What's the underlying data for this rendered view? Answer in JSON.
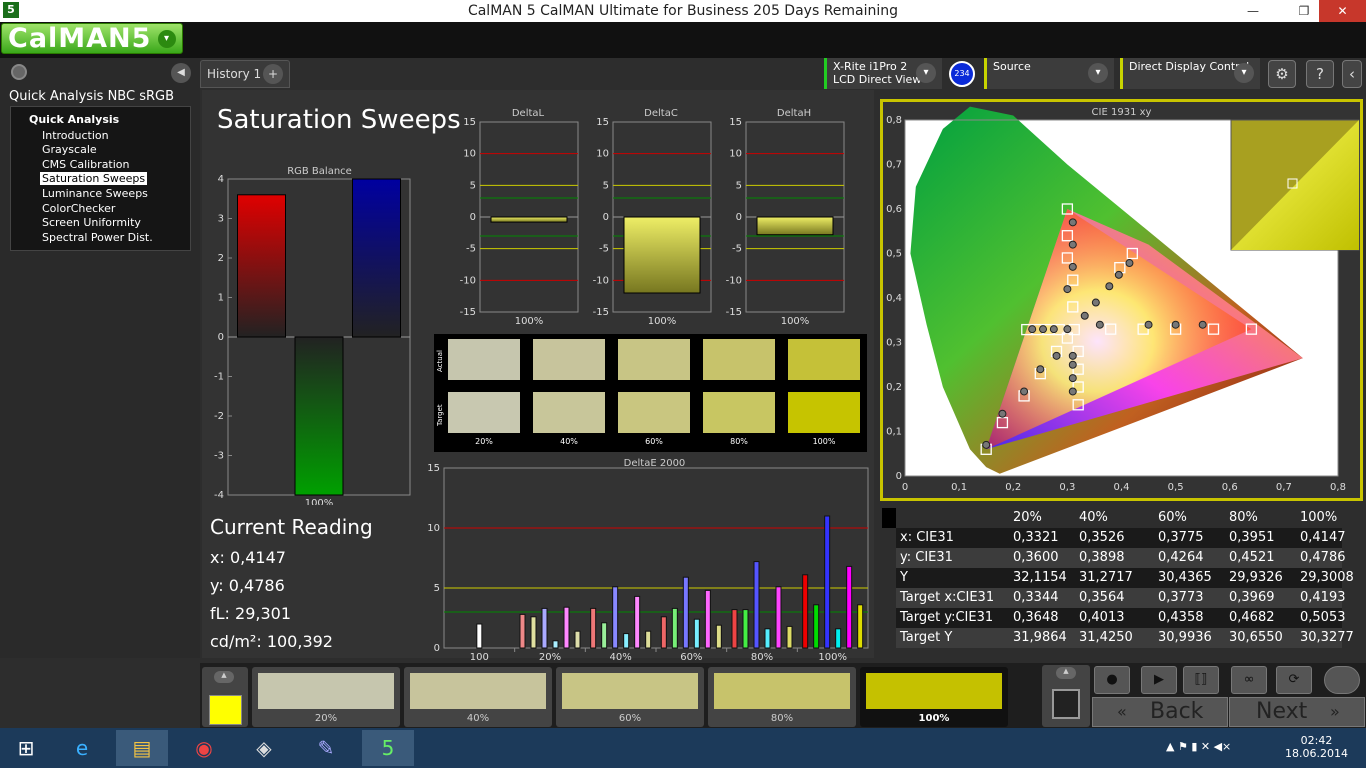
{
  "window": {
    "title": "CalMAN 5 CalMAN Ultimate for Business 205 Days Remaining",
    "app_icon": "5",
    "min": "—",
    "max": "❐",
    "close": "✕"
  },
  "logo": {
    "text": "CalMAN5",
    "dropdown": "▾"
  },
  "nav": {
    "title": "Quick Analysis NBC sRGB",
    "root": "Quick Analysis",
    "items": [
      "Introduction",
      "Grayscale",
      "CMS Calibration",
      "Saturation Sweeps",
      "Luminance Sweeps",
      "ColorChecker",
      "Screen Uniformity",
      "Spectral Power Dist."
    ],
    "selected_index": 3
  },
  "tabs": {
    "history": "History 1",
    "add": "+"
  },
  "devices": {
    "meter_line1": "X-Rite i1Pro 2",
    "meter_line2": "LCD Direct View",
    "meter_badge": "234",
    "source": "Source",
    "display": "Direct Display Control"
  },
  "toolbar_icons": [
    "gear-icon",
    "help-icon",
    "collapse-icon"
  ],
  "page": {
    "title": "Saturation Sweeps"
  },
  "current_reading": {
    "heading": "Current Reading",
    "x": "x: 0,4147",
    "y": "y: 0,4786",
    "fl": "fL: 29,301",
    "cdm2": "cd/m²: 100,392"
  },
  "swatch_labels": {
    "actual": "Actual",
    "target": "Target",
    "levels": [
      "20%",
      "40%",
      "60%",
      "80%",
      "100%"
    ]
  },
  "swatch_colors": {
    "actual": [
      "#c6c6ae",
      "#c7c49c",
      "#c8c585",
      "#c7c36b",
      "#c5c138"
    ],
    "target": [
      "#c8c8b0",
      "#c8c69a",
      "#c9c680",
      "#c8c662",
      "#c6c400"
    ]
  },
  "chart_data": [
    {
      "type": "bar",
      "title": "RGB Balance",
      "categories": [
        "100%"
      ],
      "series": [
        {
          "name": "R",
          "values": [
            3.6
          ],
          "color": "#e00000"
        },
        {
          "name": "G",
          "values": [
            -4.0
          ],
          "color": "#00a000"
        },
        {
          "name": "B",
          "values": [
            4.0
          ],
          "color": "#0000a0"
        }
      ],
      "ylim": [
        -4,
        4
      ],
      "yticks": [
        "4",
        "3",
        "2",
        "1",
        "0",
        "-1",
        "-2",
        "-3",
        "-4"
      ],
      "xlabel": "100%"
    },
    {
      "type": "bar",
      "title": "DeltaL",
      "categories": [
        "100%"
      ],
      "values": [
        -0.8
      ],
      "ylim": [
        -15,
        15
      ],
      "yticks": [
        "15",
        "10",
        "5",
        "0",
        "-5",
        "-10",
        "-15"
      ]
    },
    {
      "type": "bar",
      "title": "DeltaC",
      "categories": [
        "100%"
      ],
      "values": [
        -12
      ],
      "ylim": [
        -15,
        15
      ],
      "yticks": [
        "15",
        "10",
        "5",
        "0",
        "-5",
        "-10",
        "-15"
      ]
    },
    {
      "type": "bar",
      "title": "DeltaH",
      "categories": [
        "100%"
      ],
      "values": [
        -2.8
      ],
      "ylim": [
        -15,
        15
      ],
      "yticks": [
        "15",
        "10",
        "5",
        "0",
        "-5",
        "-10",
        "-15"
      ]
    },
    {
      "type": "bar",
      "title": "DeltaE 2000",
      "categories": [
        "100",
        "20%",
        "40%",
        "60%",
        "80%",
        "100%"
      ],
      "ylim": [
        0,
        15
      ],
      "yticks": [
        "15",
        "10",
        "5",
        "0"
      ],
      "groups": [
        {
          "values": [
            2.0
          ],
          "colors": [
            "#ffffff"
          ]
        },
        {
          "values": [
            2.8,
            2.6,
            3.3,
            0.6,
            3.4,
            1.4
          ],
          "colors": [
            "#e88",
            "#e0e0a0",
            "#aaf",
            "#aef",
            "#f8f",
            "#dda"
          ]
        },
        {
          "values": [
            3.3,
            2.1,
            5.1,
            1.2,
            4.3,
            1.4
          ],
          "colors": [
            "#e77",
            "#9e9",
            "#88f",
            "#8ef",
            "#f8f",
            "#dd9"
          ]
        },
        {
          "values": [
            2.6,
            3.3,
            5.9,
            2.4,
            4.8,
            1.9
          ],
          "colors": [
            "#e66",
            "#7e7",
            "#77f",
            "#7ef",
            "#f6f",
            "#dd8"
          ]
        },
        {
          "values": [
            3.2,
            3.2,
            7.2,
            1.6,
            5.1,
            1.8
          ],
          "colors": [
            "#e44",
            "#4e4",
            "#55f",
            "#5ef",
            "#f4f",
            "#dd6"
          ]
        },
        {
          "values": [
            6.1,
            3.6,
            11.0,
            1.6,
            6.8,
            3.6
          ],
          "colors": [
            "#e00",
            "#0d0",
            "#33f",
            "#0ee",
            "#f0f",
            "#dd0"
          ]
        }
      ]
    },
    {
      "type": "scatter",
      "title": "CIE 1931 xy",
      "xlim": [
        0,
        0.8
      ],
      "ylim": [
        0,
        0.8
      ],
      "xticks": [
        "0",
        "0,1",
        "0,2",
        "0,3",
        "0,4",
        "0,5",
        "0,6",
        "0,7",
        "0,8"
      ],
      "yticks": [
        "0",
        "0,1",
        "0,2",
        "0,3",
        "0,4",
        "0,5",
        "0,6",
        "0,7",
        "0,8"
      ],
      "targets": [
        [
          0.3127,
          0.329
        ],
        [
          0.64,
          0.33
        ],
        [
          0.57,
          0.33
        ],
        [
          0.5,
          0.33
        ],
        [
          0.44,
          0.33
        ],
        [
          0.38,
          0.33
        ],
        [
          0.3,
          0.6
        ],
        [
          0.3,
          0.54
        ],
        [
          0.3,
          0.49
        ],
        [
          0.31,
          0.44
        ],
        [
          0.31,
          0.38
        ],
        [
          0.15,
          0.06
        ],
        [
          0.18,
          0.12
        ],
        [
          0.22,
          0.18
        ],
        [
          0.25,
          0.23
        ],
        [
          0.28,
          0.28
        ],
        [
          0.225,
          0.329
        ],
        [
          0.245,
          0.329
        ],
        [
          0.265,
          0.329
        ],
        [
          0.285,
          0.329
        ],
        [
          0.32,
          0.16
        ],
        [
          0.32,
          0.2
        ],
        [
          0.32,
          0.24
        ],
        [
          0.32,
          0.28
        ],
        [
          0.3,
          0.31
        ],
        [
          0.42,
          0.5
        ],
        [
          0.3969,
          0.4682
        ]
      ],
      "actuals": [
        [
          0.3321,
          0.36
        ],
        [
          0.3526,
          0.3898
        ],
        [
          0.3775,
          0.4264
        ],
        [
          0.3951,
          0.4521
        ],
        [
          0.4147,
          0.4786
        ],
        [
          0.45,
          0.34
        ],
        [
          0.5,
          0.34
        ],
        [
          0.55,
          0.34
        ],
        [
          0.36,
          0.34
        ],
        [
          0.31,
          0.57
        ],
        [
          0.31,
          0.52
        ],
        [
          0.31,
          0.47
        ],
        [
          0.3,
          0.42
        ],
        [
          0.15,
          0.07
        ],
        [
          0.18,
          0.14
        ],
        [
          0.22,
          0.19
        ],
        [
          0.25,
          0.24
        ],
        [
          0.28,
          0.27
        ],
        [
          0.235,
          0.33
        ],
        [
          0.255,
          0.33
        ],
        [
          0.275,
          0.33
        ],
        [
          0.3,
          0.33
        ],
        [
          0.31,
          0.19
        ],
        [
          0.31,
          0.22
        ],
        [
          0.31,
          0.25
        ],
        [
          0.31,
          0.27
        ]
      ]
    }
  ],
  "cie_table": {
    "headers": [
      "",
      "20%",
      "40%",
      "60%",
      "80%",
      "100%"
    ],
    "rows": [
      [
        "x: CIE31",
        "0,3321",
        "0,3526",
        "0,3775",
        "0,3951",
        "0,4147"
      ],
      [
        "y: CIE31",
        "0,3600",
        "0,3898",
        "0,4264",
        "0,4521",
        "0,4786"
      ],
      [
        "Y",
        "32,1154",
        "31,2717",
        "30,4365",
        "29,9326",
        "29,3008"
      ],
      [
        "Target x:CIE31",
        "0,3344",
        "0,3564",
        "0,3773",
        "0,3969",
        "0,4193"
      ],
      [
        "Target y:CIE31",
        "0,3648",
        "0,4013",
        "0,4358",
        "0,4682",
        "0,5053"
      ],
      [
        "Target Y",
        "31,9864",
        "31,4250",
        "30,9936",
        "30,6550",
        "30,3277"
      ]
    ]
  },
  "bottom_swatches": {
    "labels": [
      "20%",
      "40%",
      "60%",
      "80%",
      "100%"
    ],
    "colors": [
      "#c6c6ae",
      "#c7c49c",
      "#c8c585",
      "#c7c36b",
      "#c5c100"
    ],
    "current_color": "#ffff00"
  },
  "transport": {
    "back": "Back",
    "next": "Next"
  },
  "taskbar": {
    "time": "02:42",
    "date": "18.06.2014"
  }
}
